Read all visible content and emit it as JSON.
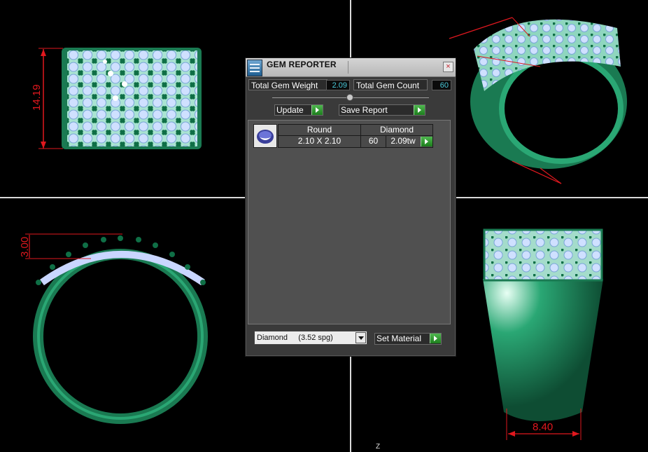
{
  "viewports": {
    "top_left": {
      "dimension": "14.19"
    },
    "bottom_left": {
      "dimension": "3.00"
    },
    "bottom_right": {
      "dimension": "8.40"
    },
    "axis_label": "Z"
  },
  "dialog": {
    "title": "GEM REPORTER",
    "close_glyph": "×",
    "total_weight_label": "Total Gem Weight",
    "total_weight_value": "2.09",
    "total_count_label": "Total Gem Count",
    "total_count_value": "60",
    "update_label": "Update",
    "save_report_label": "Save Report",
    "gems": [
      {
        "shape": "Round",
        "material": "Diamond",
        "size": "2.10 X 2.10",
        "count": "60",
        "weight": "2.09tw"
      }
    ],
    "material_select": "Diamond     (3.52 spg)",
    "set_material_label": "Set Material"
  },
  "colors": {
    "metal": "#1d8a5c",
    "stone": "#c9d6ff",
    "dimension": "#e0181e",
    "accent_go": "#2f9c2f"
  }
}
